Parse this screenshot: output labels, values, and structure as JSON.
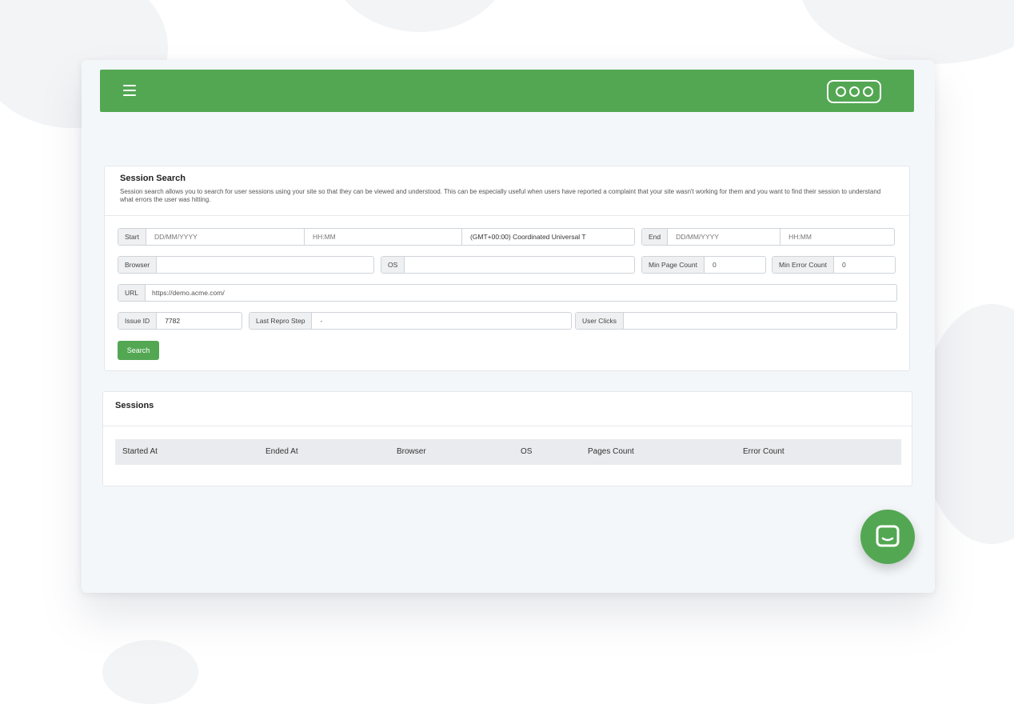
{
  "colors": {
    "accent": "#53a753",
    "page_bg": "#f4f7fa"
  },
  "topbar": {
    "menu_icon": "hamburger-menu-icon",
    "more_icon": "more-options-icon"
  },
  "session_search": {
    "title": "Session Search",
    "description": "Session search allows you to search for user sessions using your site so that they can be viewed and understood. This can be especially useful when users have reported a complaint that your site wasn't working for them and you want to find their session to understand what errors the user was hitting.",
    "start_label": "Start",
    "start_date_placeholder": "DD/MM/YYYY",
    "start_time_placeholder": "HH:MM",
    "timezone_value": "(GMT+00:00) Coordinated Universal T",
    "end_label": "End",
    "end_date_placeholder": "DD/MM/YYYY",
    "end_time_placeholder": "HH:MM",
    "browser_label": "Browser",
    "browser_value": "",
    "os_label": "OS",
    "os_value": "",
    "min_page_count_label": "Min Page Count",
    "min_page_count_value": "0",
    "min_error_count_label": "Min Error Count",
    "min_error_count_value": "0",
    "url_label": "URL",
    "url_value": "https://demo.acme.com/",
    "issue_id_label": "Issue ID",
    "issue_id_value": "7782",
    "last_repro_step_label": "Last Repro Step",
    "last_repro_step_value": "-",
    "user_clicks_label": "User Clicks",
    "user_clicks_value": "",
    "search_button": "Search"
  },
  "sessions": {
    "title": "Sessions",
    "columns": [
      "Started At",
      "Ended At",
      "Browser",
      "OS",
      "Pages Count",
      "Error Count"
    ]
  },
  "chat": {
    "icon": "chat-bubble-icon"
  }
}
